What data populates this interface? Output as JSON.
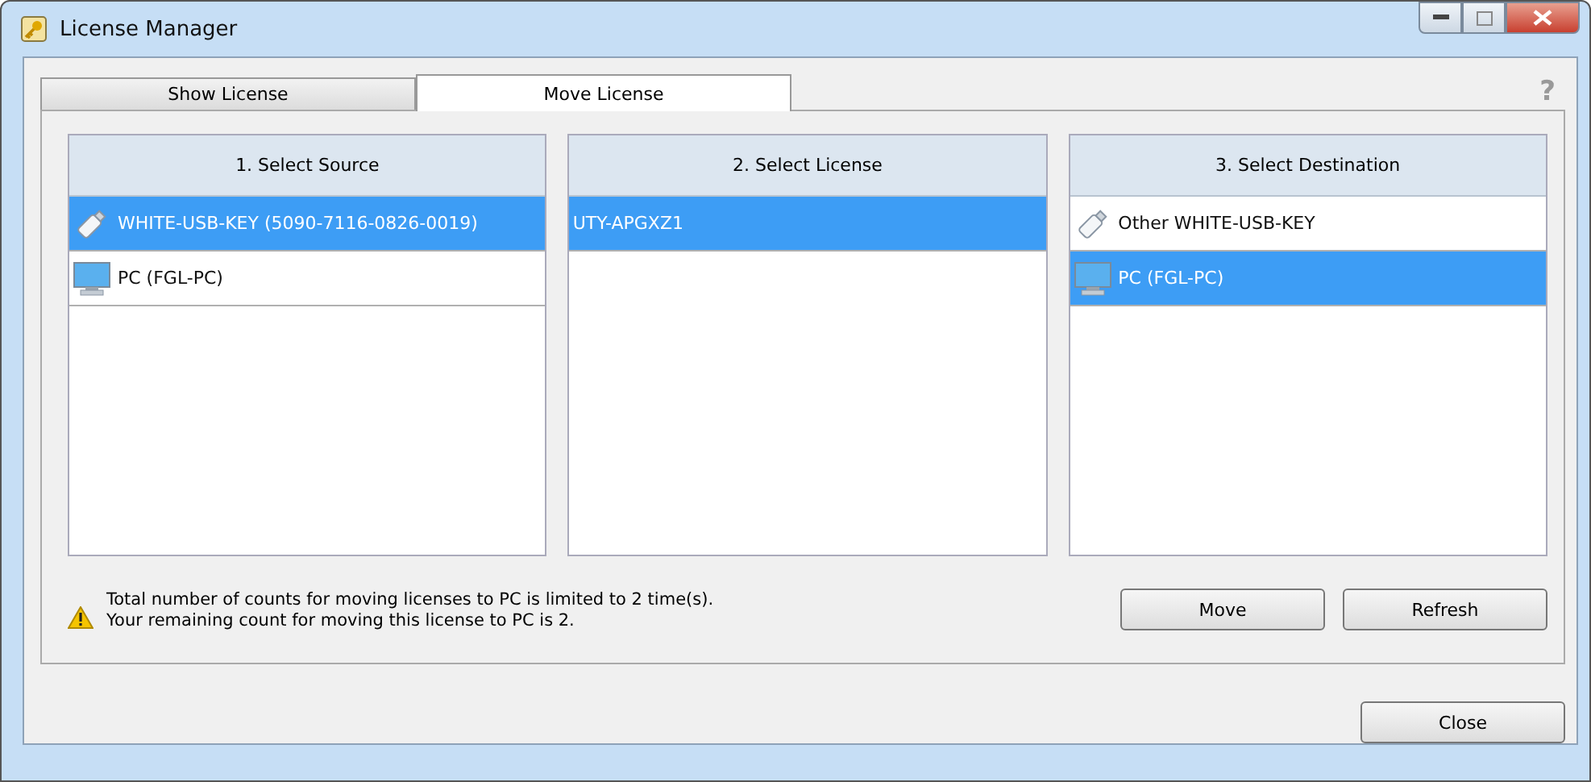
{
  "window": {
    "title": "License Manager"
  },
  "tabs": [
    {
      "label": "Show License",
      "selected": false
    },
    {
      "label": "Move License",
      "selected": true
    }
  ],
  "help": "?",
  "lists": [
    {
      "title": "1. Select Source",
      "items": [
        {
          "label": "WHITE-USB-KEY (5090-7116-0826-0019)",
          "kind": "usb",
          "selected": true
        },
        {
          "label": "PC (FGL-PC)",
          "kind": "pc",
          "selected": false
        }
      ]
    },
    {
      "title": "2. Select License",
      "items": [
        {
          "label": "UTY-APGXZ1",
          "kind": "plain",
          "selected": true
        }
      ]
    },
    {
      "title": "3. Select Destination",
      "items": [
        {
          "label": "Other WHITE-USB-KEY",
          "kind": "usb",
          "selected": false
        },
        {
          "label": "PC (FGL-PC)",
          "kind": "pc",
          "selected": true
        }
      ]
    }
  ],
  "notice": [
    "Total number of counts for moving licenses to PC is limited to 2 time(s).",
    "Your remaining count for moving this license to PC is 2."
  ],
  "actions": [
    "Move",
    "Refresh"
  ],
  "close": "Close"
}
